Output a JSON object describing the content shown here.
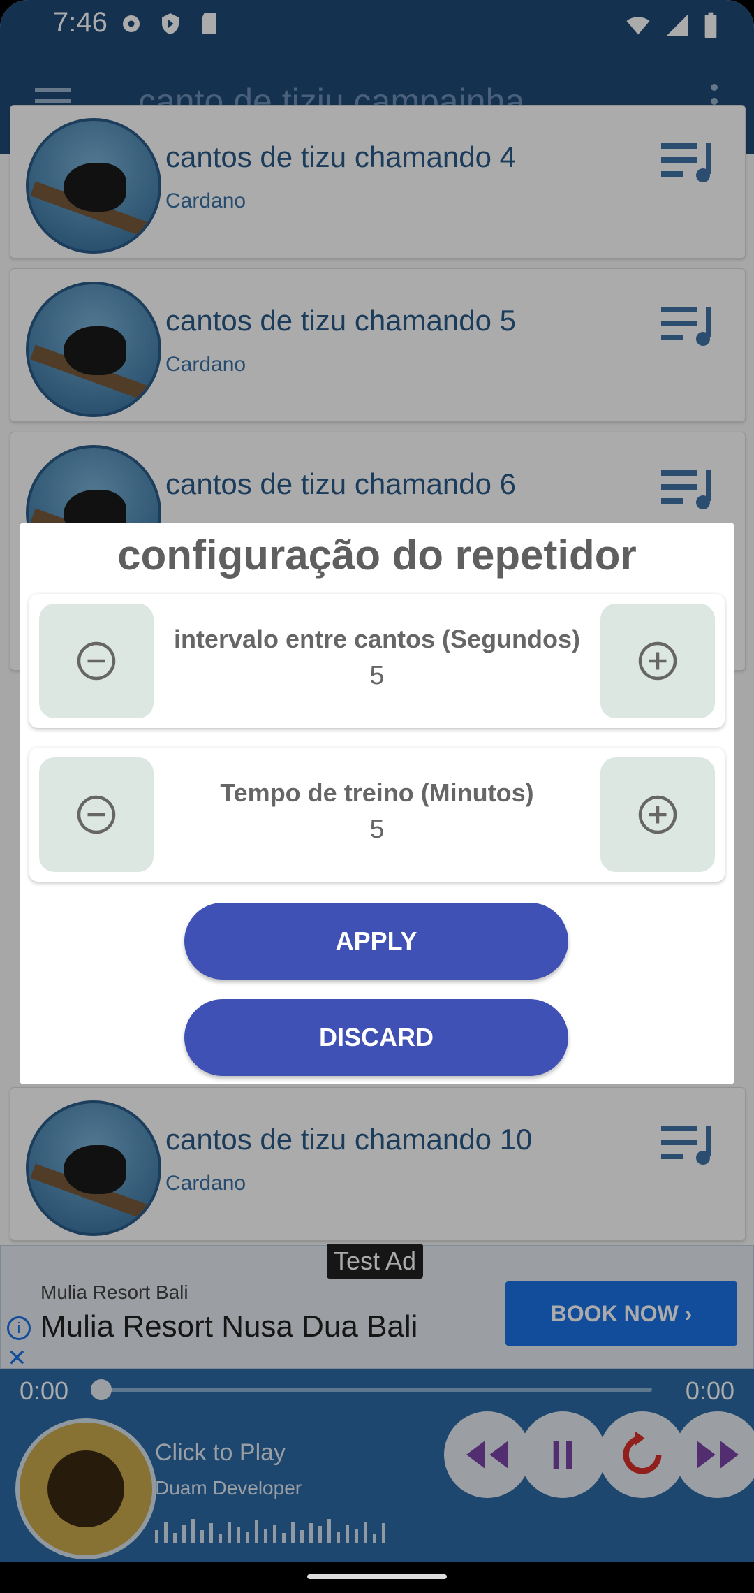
{
  "status_bar": {
    "time": "7:46"
  },
  "app_bar": {
    "title": "canto de tiziu campainha"
  },
  "list": [
    {
      "title": "cantos de tizu chamando 4",
      "subtitle": "Cardano"
    },
    {
      "title": "cantos de tizu chamando 5",
      "subtitle": "Cardano"
    },
    {
      "title": "cantos de tizu chamando 6",
      "subtitle": ""
    },
    {
      "title": "cantos de tizu chamando 10",
      "subtitle": "Cardano"
    }
  ],
  "dialog": {
    "title": "configuração do repetidor",
    "interval": {
      "label": "intervalo entre cantos (Segundos)",
      "value": "5"
    },
    "training": {
      "label": "Tempo de treino (Minutos)",
      "value": "5"
    },
    "apply_label": "APPLY",
    "discard_label": "DISCARD"
  },
  "ad": {
    "tag": "Test Ad",
    "advertiser": "Mulia Resort Bali",
    "headline": "Mulia Resort Nusa Dua Bali",
    "cta": "BOOK NOW ›"
  },
  "player": {
    "elapsed": "0:00",
    "duration": "0:00",
    "progress": 0,
    "track_title": "Click to Play",
    "developer": "Duam Developer"
  }
}
